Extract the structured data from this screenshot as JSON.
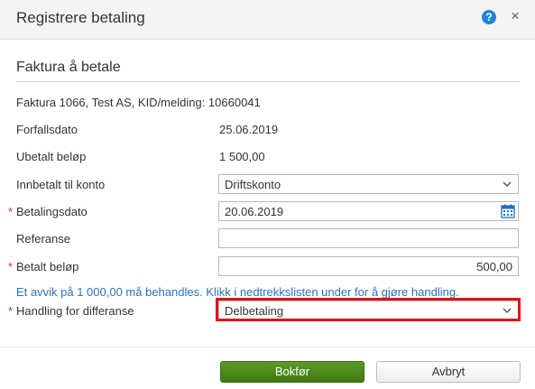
{
  "dialog": {
    "title": "Registrere betaling",
    "help_glyph": "?",
    "close_glyph": "×"
  },
  "section": {
    "title": "Faktura å betale",
    "invoice_info": "Faktura 1066, Test AS, KID/melding: 10660041"
  },
  "form": {
    "due_date": {
      "label": "Forfallsdato",
      "value": "25.06.2019"
    },
    "unpaid_amount": {
      "label": "Ubetalt beløp",
      "value": "1 500,00"
    },
    "deposit_account": {
      "label": "Innbetalt til konto",
      "value": "Driftskonto"
    },
    "payment_date": {
      "label": "Betalingsdato",
      "value": "20.06.2019",
      "required": "*"
    },
    "reference": {
      "label": "Referanse",
      "value": ""
    },
    "paid_amount": {
      "label": "Betalt beløp",
      "value": "500,00",
      "required": "*"
    },
    "warning": "Et avvik på 1 000,00 må behandles. Klikk i nedtrekkslisten under for å gjøre handling.",
    "difference_handling": {
      "label": "Handling for differanse",
      "value": "Delbetaling",
      "required": "*"
    }
  },
  "buttons": {
    "submit": "Bokfør",
    "cancel": "Avbryt"
  },
  "colors": {
    "primary_button": "#4a8a1c",
    "highlight_border": "#e3121b",
    "link_text": "#2f72b8",
    "help_icon": "#1e88d6"
  },
  "icons": [
    "help-icon",
    "close-icon",
    "chevron-down-icon",
    "calendar-icon"
  ]
}
